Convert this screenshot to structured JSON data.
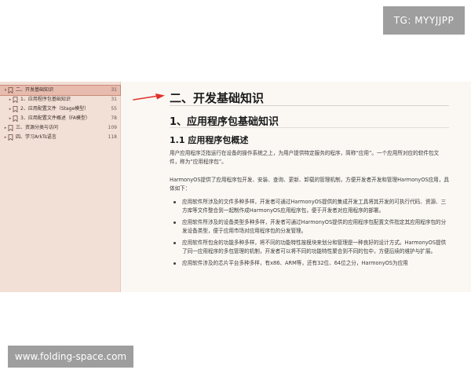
{
  "watermark_top": "TG: MYYJJPP",
  "watermark_bottom": "www.folding-space.com",
  "toc": {
    "items": [
      {
        "label": "二、开发基础知识",
        "page": "31"
      },
      {
        "label": "1、应用程序包基础知识",
        "page": "31"
      },
      {
        "label": "2、应用配置文件（Stage模型）",
        "page": "55"
      },
      {
        "label": "3、应用配置文件概述（FA模型）",
        "page": "78"
      },
      {
        "label": "三、资源分类与访问",
        "page": "109"
      },
      {
        "label": "四、学习ArkTs语言",
        "page": "118"
      }
    ]
  },
  "doc": {
    "h1": "二、开发基础知识",
    "h2": "1、应用程序包基础知识",
    "h3": "1.1 应用程序包概述",
    "p1": "用户应用程序泛指运行在设备的操作系统之上，为用户提供特定服务的程序，简称“应用”。一个应用所对应的软件包文件，称为“应用程序包”。",
    "p2": "HarmonyOS提供了应用程序包开发、安装、查询、更新、卸载的管理机制，方便开发者开发和管理HarmonyOS应用，具体如下：",
    "bullets": [
      "应用软件所涉及的文件多种多样，开发者可通过HarmonyOS提供的集成开发工具将其开发的可执行代码、资源、三方库等文件整合到一起制作成HarmonyOS应用程序包，便于开发者对应用程序的部署。",
      "应用软件所涉及的设备类型多种多样，开发者可通过HarmonyOS提供的应用程序包配置文件指定其应用程序包的分发设备类型，便于应用市场对应用程序包的分发管理。",
      "应用软件所包含的功能多种多样，将不同的功能特性按模块来划分和管理是一种良好的设计方式。HarmonyOS提供了同一应用程序的多包管理的机制，开发者可以将不同的功能特性聚合到不同的包中，方便后续的维护与扩展。",
      "应用软件涉及的芯片平台多种多样，有x86、ARM等，还有32位、64位之分，HarmonyOS为应用"
    ]
  },
  "colors": {
    "sidebar_bg": "#f2dfd5",
    "active_bg": "#e7bcae",
    "arrow": "#e0322a",
    "watermark_bg": "#9e9e9e"
  },
  "icons": {
    "bookmark": "bookmark-icon",
    "expand": "triangle-right-icon",
    "pointer": "red-arrow-icon"
  }
}
